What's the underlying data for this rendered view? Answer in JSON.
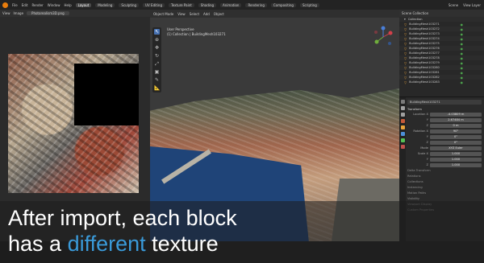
{
  "topbar": {
    "menus": [
      "File",
      "Edit",
      "Render",
      "Window",
      "Help"
    ],
    "workspaces": [
      "Layout",
      "Modeling",
      "Sculpting",
      "UV Editing",
      "Texture Paint",
      "Shading",
      "Animation",
      "Rendering",
      "Compositing",
      "Scripting"
    ],
    "active_workspace": "Layout",
    "scene": "Scene",
    "view_layer": "View Layer"
  },
  "image_editor": {
    "menus": [
      "View",
      "Image"
    ],
    "image_name": "Photorealism3D.png"
  },
  "viewport": {
    "menus": [
      "Object Mode",
      "View",
      "Select",
      "Add",
      "Object"
    ],
    "info_line1": "User Perspective",
    "info_line2": "(1) Collection | BuildingMesh103271",
    "tools": [
      "cursor",
      "move",
      "rotate",
      "scale",
      "transform",
      "annotate",
      "measure"
    ]
  },
  "outliner": {
    "title": "Scene Collection",
    "collection": "Collection",
    "items": [
      "BuildingMesh103271",
      "BuildingMesh103272",
      "BuildingMesh103273",
      "BuildingMesh103274",
      "BuildingMesh103275",
      "BuildingMesh103276",
      "BuildingMesh103277",
      "BuildingMesh103278",
      "BuildingMesh103279",
      "BuildingMesh103280",
      "BuildingMesh103281",
      "BuildingMesh103282",
      "BuildingMesh103283"
    ]
  },
  "properties": {
    "object_name": "BuildingMesh103271",
    "section_transform": "Transform",
    "location_label": "Location X",
    "location": [
      "-4.03809 m",
      "2.67484 m",
      "0 m"
    ],
    "rotation_label": "Rotation X",
    "rotation": [
      "90°",
      "0°",
      "0°"
    ],
    "mode_label": "Mode",
    "mode_value": "XYZ Euler",
    "scale_label": "Scale X",
    "scale": [
      "1.000",
      "1.000",
      "1.000"
    ],
    "collapsed_sections": [
      "Delta Transform",
      "Relations",
      "Collections",
      "Instancing",
      "Motion Paths",
      "Visibility",
      "Viewport Display",
      "Custom Properties"
    ]
  },
  "caption": {
    "line1": "After import, each block",
    "line2_before": "has a ",
    "line2_accent": "different",
    "line2_after": " texture"
  },
  "colors": {
    "accent_blue": "#3a9ad9",
    "active_tool": "#4772b3",
    "blender_orange": "#e87d0d"
  }
}
